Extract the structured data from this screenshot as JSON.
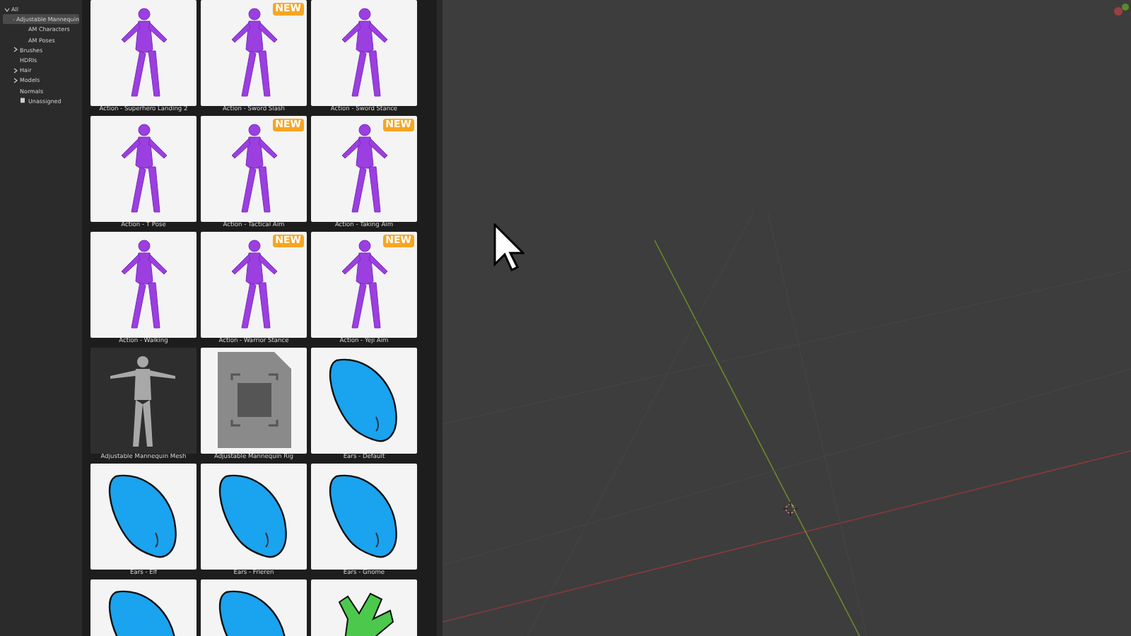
{
  "sidebar": {
    "tree": [
      {
        "label": "All",
        "expanded": true,
        "selected": false,
        "children": [
          {
            "label": "Adjustable Mannequin",
            "expanded": true,
            "selected": true,
            "children": [
              {
                "label": "AM Characters",
                "selected": false
              },
              {
                "label": "AM Poses",
                "selected": false
              }
            ]
          },
          {
            "label": "Brushes",
            "expanded": false,
            "selected": false
          },
          {
            "label": "HDRIs",
            "selected": false
          },
          {
            "label": "Hair",
            "expanded": false,
            "selected": false
          },
          {
            "label": "Models",
            "expanded": false,
            "selected": false
          },
          {
            "label": "Normals",
            "selected": false
          },
          {
            "label": "Unassigned",
            "selected": false,
            "kind": "unassigned"
          }
        ]
      }
    ]
  },
  "assets": [
    {
      "name": "Action - Superhero Landing 2",
      "kind": "pose"
    },
    {
      "name": "Action - Sword Slash",
      "kind": "pose",
      "badge": "NEW"
    },
    {
      "name": "Action - Sword Stance",
      "kind": "pose"
    },
    {
      "name": "Action - T Pose",
      "kind": "pose"
    },
    {
      "name": "Action - Tactical Aim",
      "kind": "pose",
      "badge": "NEW"
    },
    {
      "name": "Action - Taking Aim",
      "kind": "pose",
      "badge": "NEW"
    },
    {
      "name": "Action - Walking",
      "kind": "pose"
    },
    {
      "name": "Action - Warrior Stance",
      "kind": "pose",
      "badge": "NEW"
    },
    {
      "name": "Action - Yeji Aim",
      "kind": "pose",
      "badge": "NEW"
    },
    {
      "name": "Adjustable Mannequin Mesh",
      "kind": "mesh"
    },
    {
      "name": "Adjustable Mannequin Rig",
      "kind": "placeholder"
    },
    {
      "name": "Ears - Default",
      "kind": "ear"
    },
    {
      "name": "Ears - Elf",
      "kind": "ear"
    },
    {
      "name": "Ears - Frieren",
      "kind": "ear"
    },
    {
      "name": "Ears - Gnome",
      "kind": "ear"
    },
    {
      "kind": "ear"
    },
    {
      "kind": "ear"
    },
    {
      "kind": "hand"
    }
  ]
}
